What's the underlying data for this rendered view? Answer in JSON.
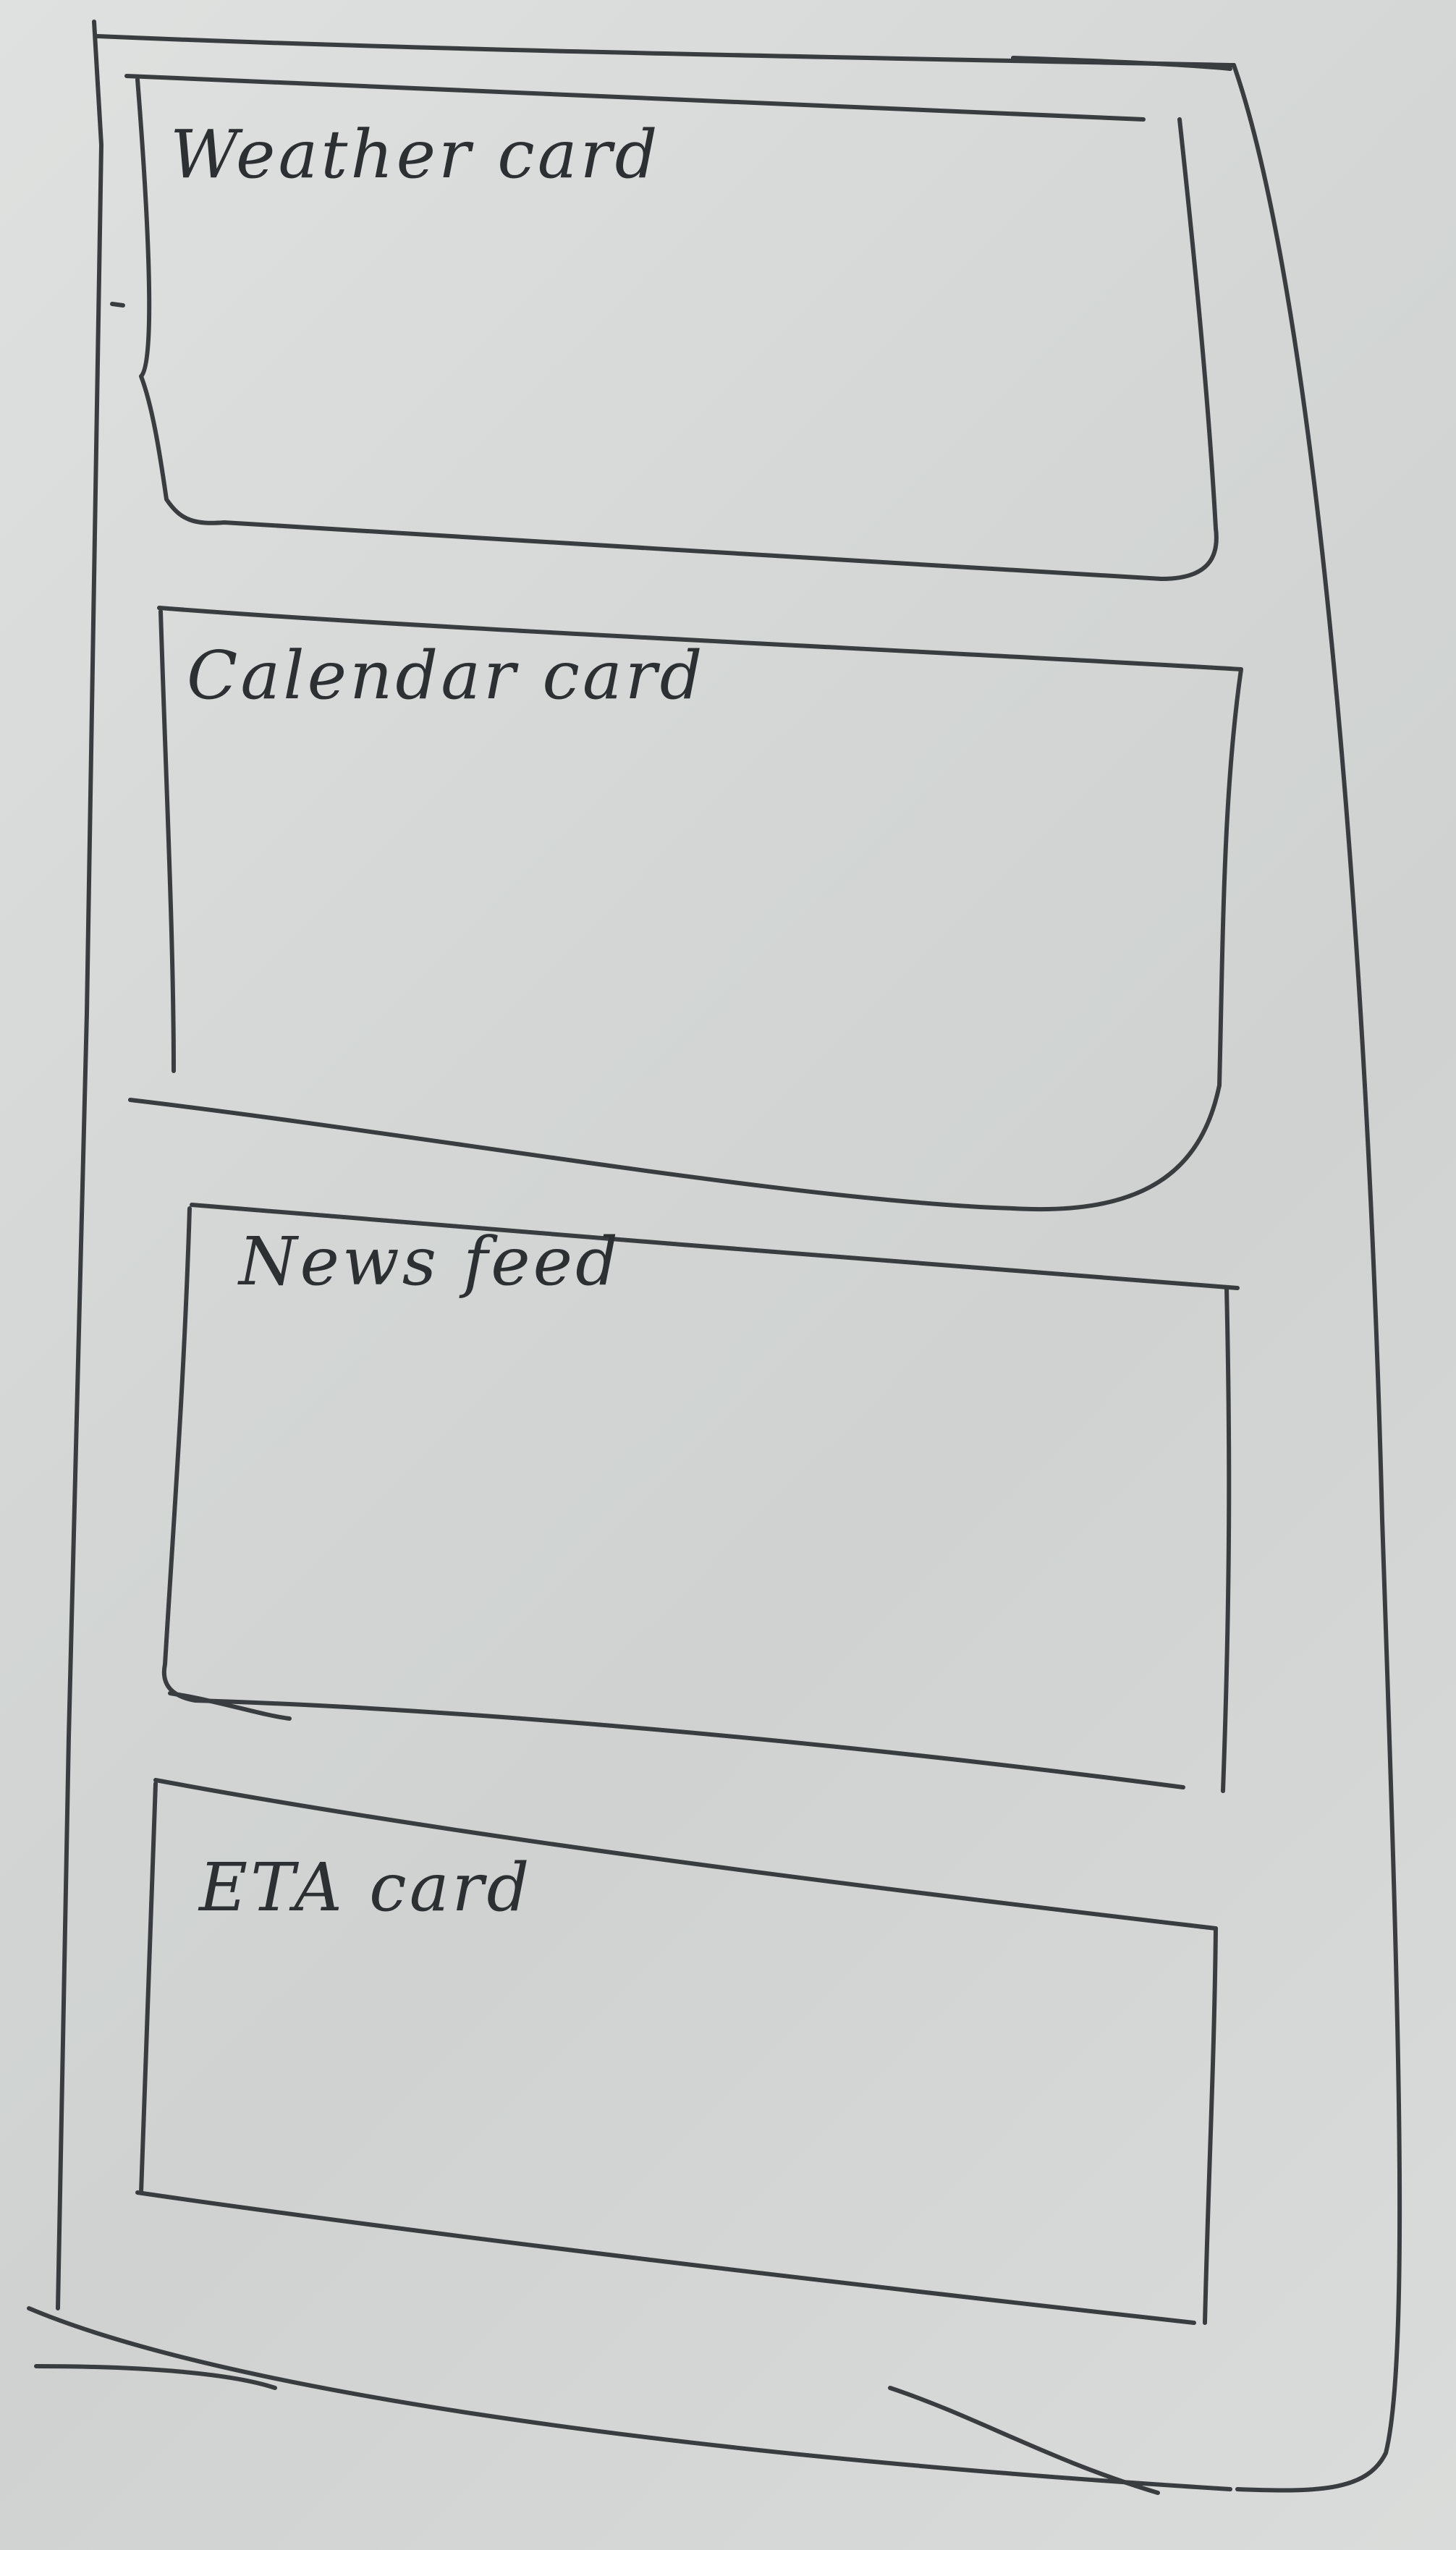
{
  "cards": [
    {
      "id": "weather",
      "label": "Weather card"
    },
    {
      "id": "calendar",
      "label": "Calendar card"
    },
    {
      "id": "news",
      "label": "News feed"
    },
    {
      "id": "eta",
      "label": "ETA card"
    }
  ]
}
